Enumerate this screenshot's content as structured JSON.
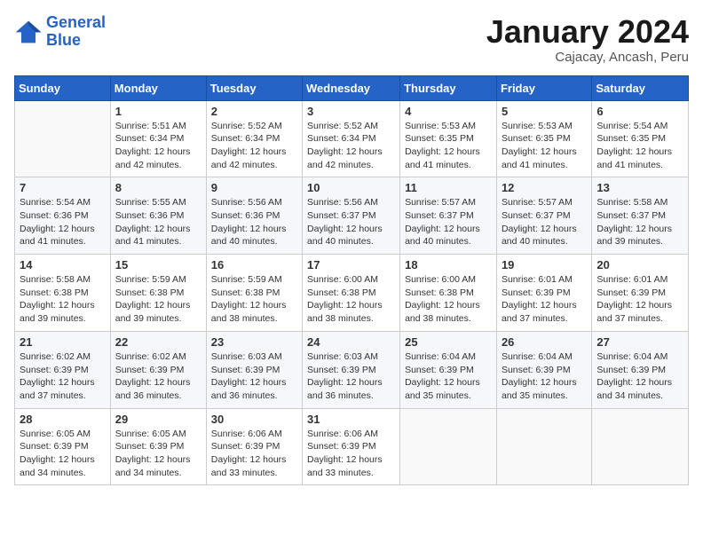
{
  "header": {
    "logo_line1": "General",
    "logo_line2": "Blue",
    "month": "January 2024",
    "location": "Cajacay, Ancash, Peru"
  },
  "weekdays": [
    "Sunday",
    "Monday",
    "Tuesday",
    "Wednesday",
    "Thursday",
    "Friday",
    "Saturday"
  ],
  "weeks": [
    [
      {
        "day": "",
        "info": ""
      },
      {
        "day": "1",
        "info": "Sunrise: 5:51 AM\nSunset: 6:34 PM\nDaylight: 12 hours and 42 minutes."
      },
      {
        "day": "2",
        "info": "Sunrise: 5:52 AM\nSunset: 6:34 PM\nDaylight: 12 hours and 42 minutes."
      },
      {
        "day": "3",
        "info": "Sunrise: 5:52 AM\nSunset: 6:34 PM\nDaylight: 12 hours and 42 minutes."
      },
      {
        "day": "4",
        "info": "Sunrise: 5:53 AM\nSunset: 6:35 PM\nDaylight: 12 hours and 41 minutes."
      },
      {
        "day": "5",
        "info": "Sunrise: 5:53 AM\nSunset: 6:35 PM\nDaylight: 12 hours and 41 minutes."
      },
      {
        "day": "6",
        "info": "Sunrise: 5:54 AM\nSunset: 6:35 PM\nDaylight: 12 hours and 41 minutes."
      }
    ],
    [
      {
        "day": "7",
        "info": "Sunrise: 5:54 AM\nSunset: 6:36 PM\nDaylight: 12 hours and 41 minutes."
      },
      {
        "day": "8",
        "info": "Sunrise: 5:55 AM\nSunset: 6:36 PM\nDaylight: 12 hours and 41 minutes."
      },
      {
        "day": "9",
        "info": "Sunrise: 5:56 AM\nSunset: 6:36 PM\nDaylight: 12 hours and 40 minutes."
      },
      {
        "day": "10",
        "info": "Sunrise: 5:56 AM\nSunset: 6:37 PM\nDaylight: 12 hours and 40 minutes."
      },
      {
        "day": "11",
        "info": "Sunrise: 5:57 AM\nSunset: 6:37 PM\nDaylight: 12 hours and 40 minutes."
      },
      {
        "day": "12",
        "info": "Sunrise: 5:57 AM\nSunset: 6:37 PM\nDaylight: 12 hours and 40 minutes."
      },
      {
        "day": "13",
        "info": "Sunrise: 5:58 AM\nSunset: 6:37 PM\nDaylight: 12 hours and 39 minutes."
      }
    ],
    [
      {
        "day": "14",
        "info": "Sunrise: 5:58 AM\nSunset: 6:38 PM\nDaylight: 12 hours and 39 minutes."
      },
      {
        "day": "15",
        "info": "Sunrise: 5:59 AM\nSunset: 6:38 PM\nDaylight: 12 hours and 39 minutes."
      },
      {
        "day": "16",
        "info": "Sunrise: 5:59 AM\nSunset: 6:38 PM\nDaylight: 12 hours and 38 minutes."
      },
      {
        "day": "17",
        "info": "Sunrise: 6:00 AM\nSunset: 6:38 PM\nDaylight: 12 hours and 38 minutes."
      },
      {
        "day": "18",
        "info": "Sunrise: 6:00 AM\nSunset: 6:38 PM\nDaylight: 12 hours and 38 minutes."
      },
      {
        "day": "19",
        "info": "Sunrise: 6:01 AM\nSunset: 6:39 PM\nDaylight: 12 hours and 37 minutes."
      },
      {
        "day": "20",
        "info": "Sunrise: 6:01 AM\nSunset: 6:39 PM\nDaylight: 12 hours and 37 minutes."
      }
    ],
    [
      {
        "day": "21",
        "info": "Sunrise: 6:02 AM\nSunset: 6:39 PM\nDaylight: 12 hours and 37 minutes."
      },
      {
        "day": "22",
        "info": "Sunrise: 6:02 AM\nSunset: 6:39 PM\nDaylight: 12 hours and 36 minutes."
      },
      {
        "day": "23",
        "info": "Sunrise: 6:03 AM\nSunset: 6:39 PM\nDaylight: 12 hours and 36 minutes."
      },
      {
        "day": "24",
        "info": "Sunrise: 6:03 AM\nSunset: 6:39 PM\nDaylight: 12 hours and 36 minutes."
      },
      {
        "day": "25",
        "info": "Sunrise: 6:04 AM\nSunset: 6:39 PM\nDaylight: 12 hours and 35 minutes."
      },
      {
        "day": "26",
        "info": "Sunrise: 6:04 AM\nSunset: 6:39 PM\nDaylight: 12 hours and 35 minutes."
      },
      {
        "day": "27",
        "info": "Sunrise: 6:04 AM\nSunset: 6:39 PM\nDaylight: 12 hours and 34 minutes."
      }
    ],
    [
      {
        "day": "28",
        "info": "Sunrise: 6:05 AM\nSunset: 6:39 PM\nDaylight: 12 hours and 34 minutes."
      },
      {
        "day": "29",
        "info": "Sunrise: 6:05 AM\nSunset: 6:39 PM\nDaylight: 12 hours and 34 minutes."
      },
      {
        "day": "30",
        "info": "Sunrise: 6:06 AM\nSunset: 6:39 PM\nDaylight: 12 hours and 33 minutes."
      },
      {
        "day": "31",
        "info": "Sunrise: 6:06 AM\nSunset: 6:39 PM\nDaylight: 12 hours and 33 minutes."
      },
      {
        "day": "",
        "info": ""
      },
      {
        "day": "",
        "info": ""
      },
      {
        "day": "",
        "info": ""
      }
    ]
  ]
}
